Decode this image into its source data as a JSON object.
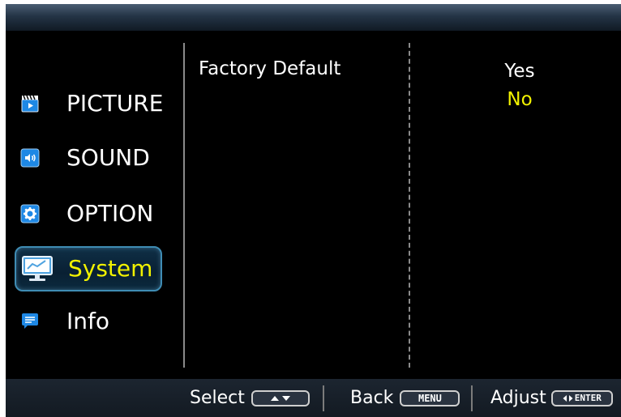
{
  "menu": {
    "items": [
      {
        "label": "PICTURE",
        "icon": "picture-icon",
        "selected": false
      },
      {
        "label": "SOUND",
        "icon": "sound-icon",
        "selected": false
      },
      {
        "label": "OPTION",
        "icon": "option-gear-icon",
        "selected": false
      },
      {
        "label": "System",
        "icon": "system-monitor-icon",
        "selected": true
      },
      {
        "label": "Info",
        "icon": "info-message-icon",
        "selected": false
      }
    ]
  },
  "setting": {
    "name": "Factory Default",
    "options": [
      {
        "label": "Yes",
        "highlighted": false
      },
      {
        "label": "No",
        "highlighted": true
      }
    ]
  },
  "footer": {
    "select_label": "Select",
    "back_label": "Back",
    "back_key": "MENU",
    "adjust_label": "Adjust",
    "adjust_key": "ENTER"
  },
  "colors": {
    "highlight": "#f2f200",
    "selected_border": "#3f8cb4",
    "icon_blue": "#1e88e5"
  }
}
